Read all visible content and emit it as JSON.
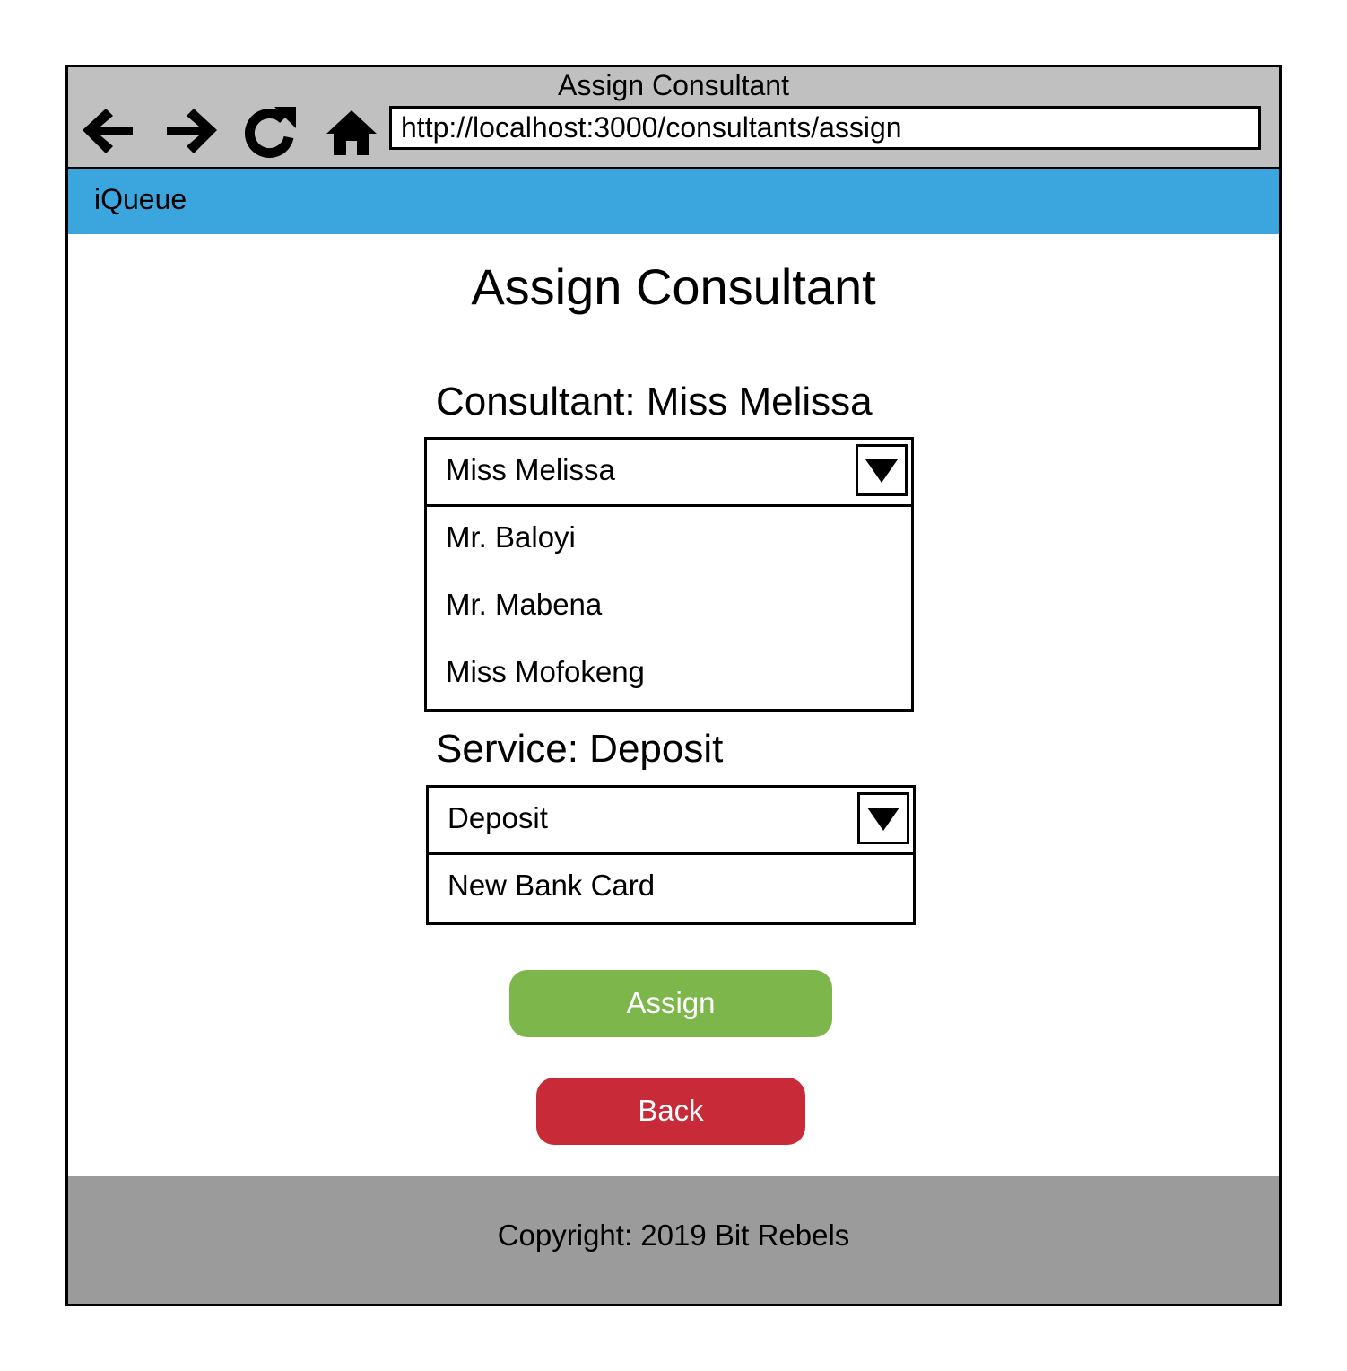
{
  "window": {
    "title": "Assign Consultant",
    "url": "http://localhost:3000/consultants/assign",
    "nav_icons": [
      "back-arrow-icon",
      "forward-arrow-icon",
      "reload-icon",
      "home-icon"
    ]
  },
  "app_bar": {
    "brand": "iQueue",
    "color": "#3ba5dd"
  },
  "page": {
    "title": "Assign Consultant"
  },
  "consultant": {
    "label": "Consultant: Miss Melissa",
    "selected": "Miss Melissa",
    "options": [
      "Mr. Baloyi",
      "Mr. Mabena",
      "Miss Mofokeng"
    ]
  },
  "service": {
    "label": "Service: Deposit",
    "selected": "Deposit",
    "options": [
      "New Bank Card"
    ]
  },
  "buttons": {
    "assign_label": "Assign",
    "assign_color": "#7db64a",
    "back_label": "Back",
    "back_color": "#c92a37"
  },
  "footer": {
    "text": "Copyright: 2019 Bit Rebels"
  }
}
